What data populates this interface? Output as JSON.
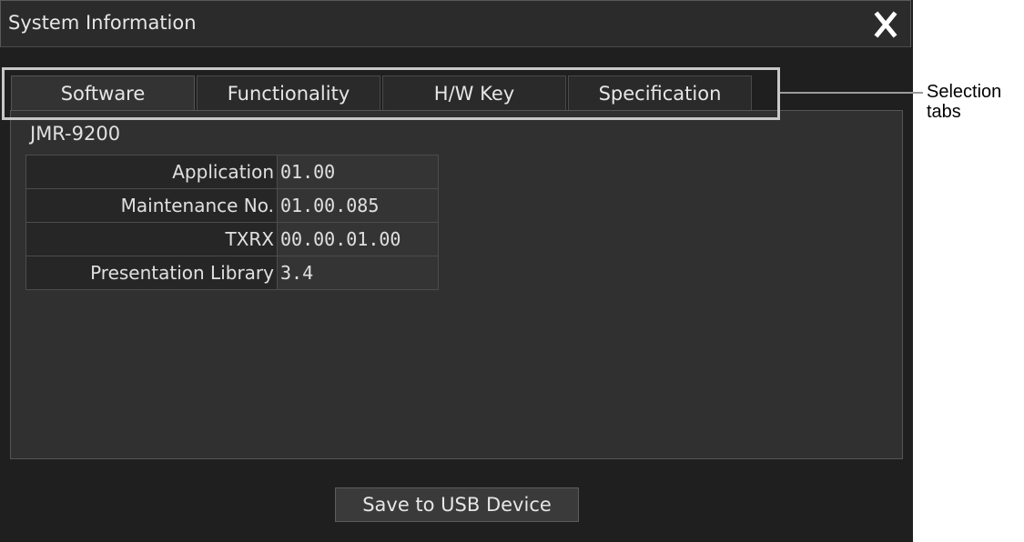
{
  "window": {
    "title": "System Information"
  },
  "tabs": [
    {
      "label": "Software",
      "active": true
    },
    {
      "label": "Functionality",
      "active": false
    },
    {
      "label": "H/W Key",
      "active": false
    },
    {
      "label": "Specification",
      "active": false
    }
  ],
  "model": "JMR-9200",
  "info_rows": [
    {
      "key": "Application",
      "value": "01.00"
    },
    {
      "key": "Maintenance No.",
      "value": "01.00.085"
    },
    {
      "key": "TXRX",
      "value": "00.00.01.00"
    },
    {
      "key": "Presentation Library",
      "value": "3.4"
    }
  ],
  "buttons": {
    "save_usb": "Save to USB Device"
  },
  "annotation": {
    "line1": "Selection",
    "line2": "tabs"
  },
  "icons": {
    "close": "close-icon"
  },
  "colors": {
    "background": "#1f1f1f",
    "panel": "#303030",
    "text": "#e6e6e6"
  }
}
